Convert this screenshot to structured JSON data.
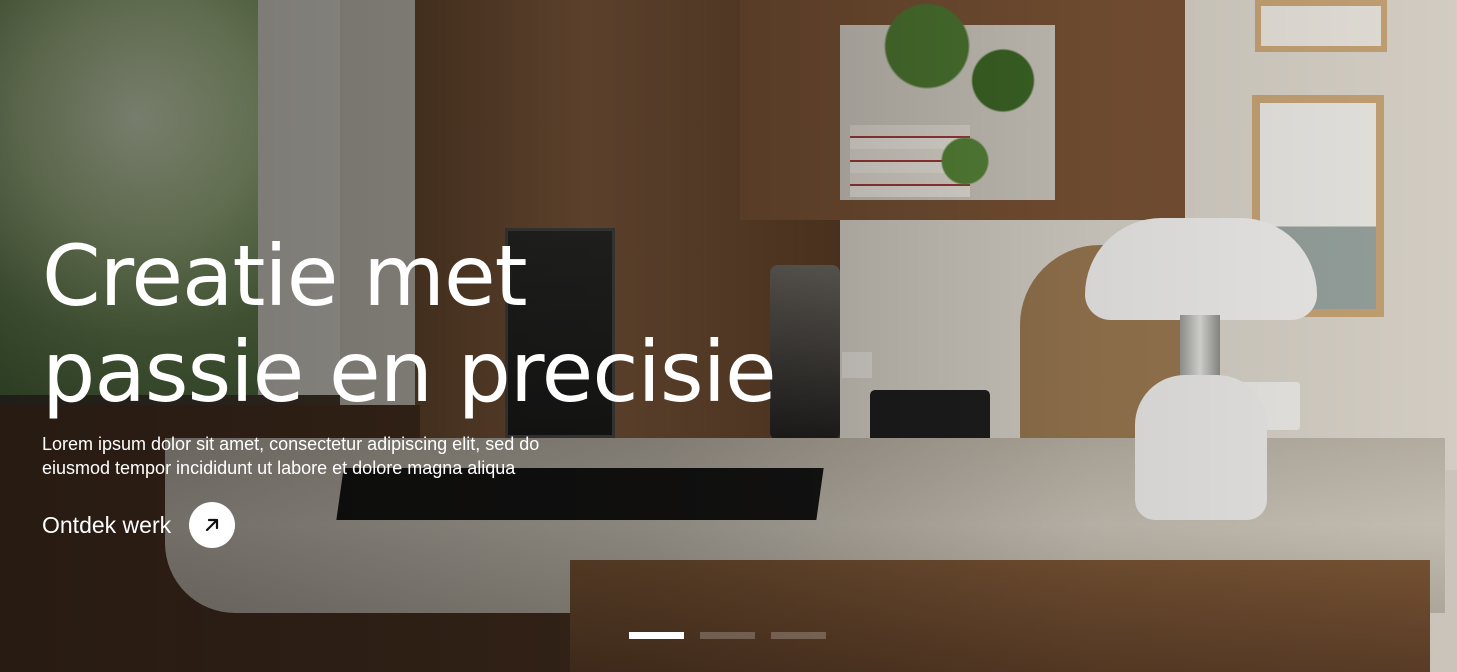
{
  "hero": {
    "headline_line1": "Creatie met",
    "headline_line2": "passie en precisie",
    "lede": "Lorem ipsum dolor sit amet, consectetur adipiscing elit, sed do eiusmod tempor incididunt ut labore et dolore magna aliqua",
    "cta_label": "Ontdek werk",
    "cta_icon": "arrow-up-right-icon"
  },
  "pager": {
    "slides": 3,
    "active_index": 0
  },
  "colors": {
    "text": "#ffffff",
    "cta_circle": "#ffffff",
    "pager_active": "#ffffff"
  }
}
